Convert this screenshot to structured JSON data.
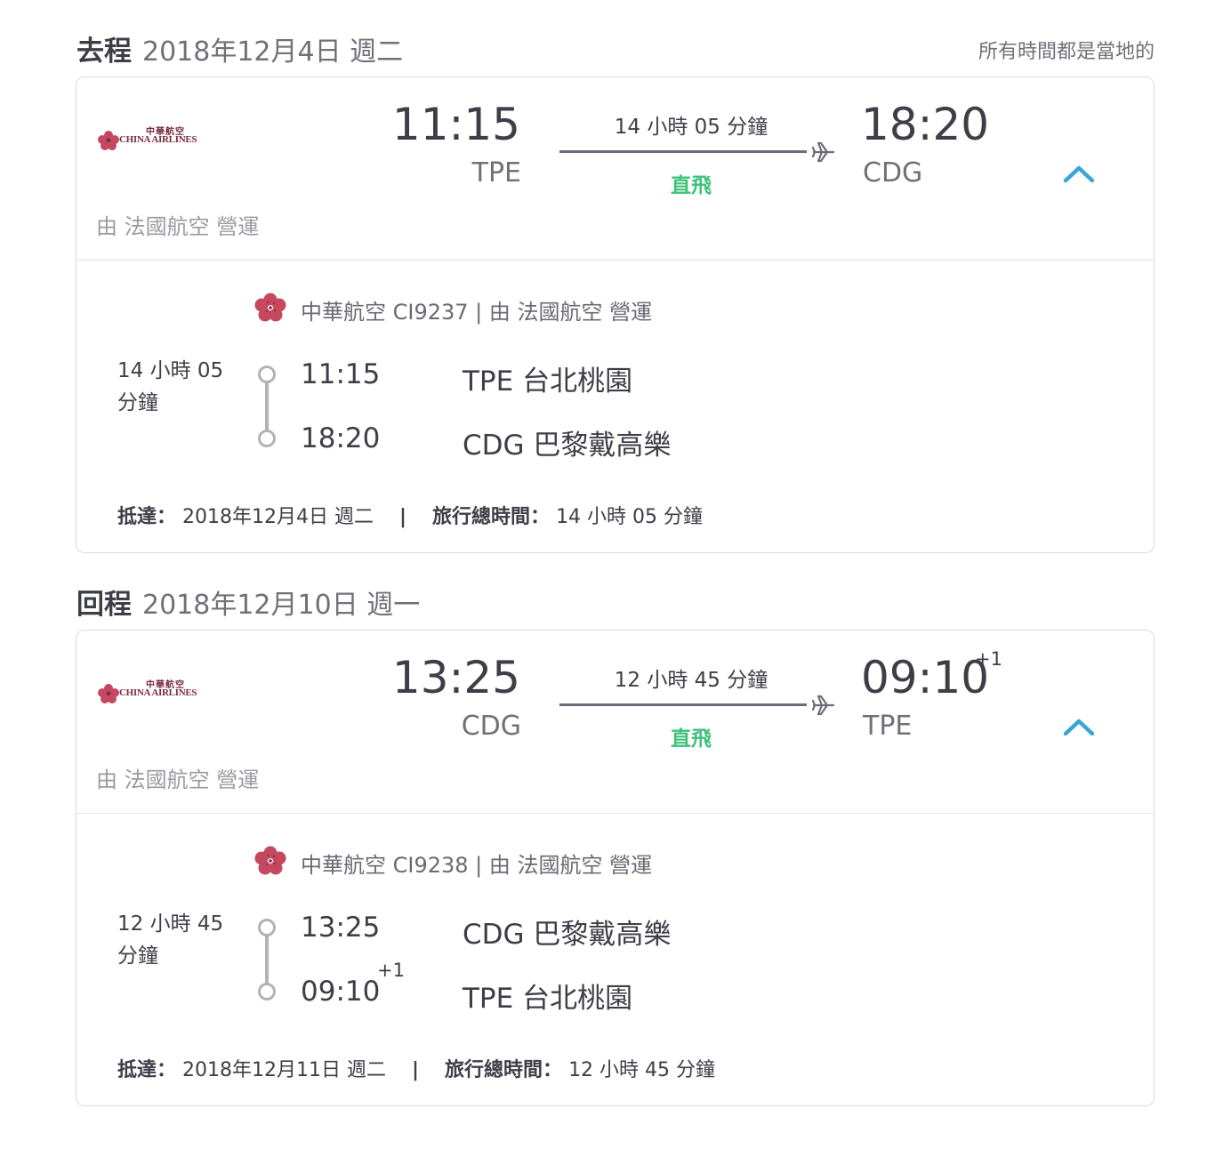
{
  "outbound": {
    "label": "去程",
    "date": "2018年12月4日 週二",
    "timezone_note": "所有時間都是當地的",
    "airline_logo_zh": "中華航空",
    "airline_logo_en": "CHINA AIRLINES",
    "dep_time": "11:15",
    "dep_code": "TPE",
    "duration": "14 小時 05 分鐘",
    "nonstop": "直飛",
    "arr_time": "18:20",
    "arr_code": "CDG",
    "operated_by": "由 法國航空 營運",
    "segment": {
      "flight_info": "中華航空 CI9237 | 由 法國航空 營運",
      "duration": "14 小時 05 分鐘",
      "dep_time": "11:15",
      "dep_airport": "TPE 台北桃園",
      "arr_time": "18:20",
      "arr_airport": "CDG 巴黎戴高樂"
    },
    "arrival_label": "抵達：",
    "arrival_date": "2018年12月4日 週二",
    "separator": "|",
    "total_label": "旅行總時間：",
    "total_time": "14 小時 05 分鐘"
  },
  "inbound": {
    "label": "回程",
    "date": "2018年12月10日 週一",
    "airline_logo_zh": "中華航空",
    "airline_logo_en": "CHINA AIRLINES",
    "dep_time": "13:25",
    "dep_code": "CDG",
    "duration": "12 小時 45 分鐘",
    "nonstop": "直飛",
    "arr_time": "09:10",
    "arr_plus": "+1",
    "arr_code": "TPE",
    "operated_by": "由 法國航空 營運",
    "segment": {
      "flight_info": "中華航空 CI9238 | 由 法國航空 營運",
      "duration": "12 小時 45 分鐘",
      "dep_time": "13:25",
      "dep_airport": "CDG 巴黎戴高樂",
      "arr_time": "09:10",
      "arr_plus": "+1",
      "arr_airport": "TPE 台北桃園"
    },
    "arrival_label": "抵達：",
    "arrival_date": "2018年12月11日 週二",
    "separator": "|",
    "total_label": "旅行總時間：",
    "total_time": "12 小時 45 分鐘"
  },
  "colors": {
    "nonstop": "#3ec27a",
    "chevron": "#3ba5d8",
    "brand": "#7a2a3e"
  },
  "icons": {
    "plane": "plane-icon",
    "collapse": "chevron-up-icon",
    "airline": "plum-blossom-icon"
  }
}
